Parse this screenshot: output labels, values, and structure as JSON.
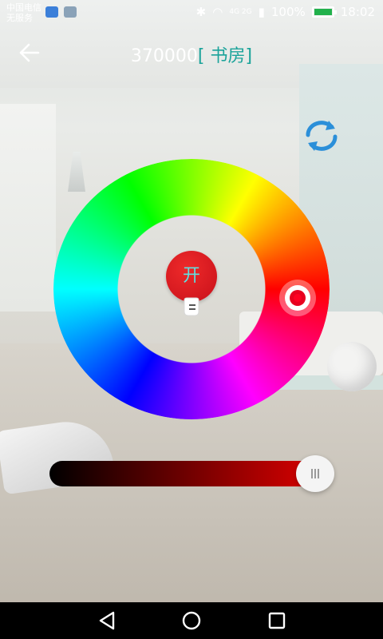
{
  "status_bar": {
    "carrier_line1": "中国电信",
    "carrier_line2": "无服务",
    "network": "4G 2G",
    "battery_percent": "100%",
    "time": "18:02"
  },
  "header": {
    "device_id": "370000",
    "room_name": "[ 书房]"
  },
  "colors": {
    "accent_teal": "#1aa39a",
    "power_red": "#d4141f",
    "selected_color": "#ff0022"
  },
  "control": {
    "power_label": "开",
    "brightness_level": 0.93,
    "hue_deg": 0
  },
  "icons": {
    "back": "back-arrow-icon",
    "refresh": "refresh-icon",
    "bulb": "bulb-icon",
    "nav_back": "triangle-back-icon",
    "nav_home": "circle-home-icon",
    "nav_recent": "square-recent-icon"
  }
}
